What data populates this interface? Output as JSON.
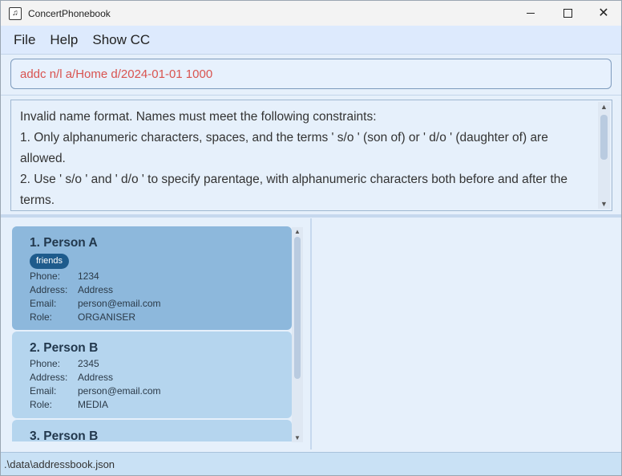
{
  "window": {
    "title": "ConcertPhonebook",
    "app_icon": "music-note-icon",
    "controls": {
      "minimize": "minimize-icon",
      "maximize": "maximize-icon",
      "close": "close-icon"
    }
  },
  "menu": {
    "items": [
      {
        "label": "File"
      },
      {
        "label": "Help"
      },
      {
        "label": "Show CC"
      }
    ]
  },
  "command": {
    "value": "addc n/l a/Home d/2024-01-01 1000",
    "text_color": "#d9534f"
  },
  "result": {
    "text": "Invalid name format. Names must meet the following constraints:\n1. Only alphanumeric characters, spaces, and the terms ' s/o ' (son of) or ' d/o ' (daughter of) are allowed.\n2. Use ' s/o ' and ' d/o ' to specify parentage, with alphanumeric characters both before and after the terms."
  },
  "persons": [
    {
      "name": "1. Person A",
      "tags": [
        "friends"
      ],
      "fields": [
        {
          "key": "Phone:",
          "value": "1234"
        },
        {
          "key": "Address:",
          "value": "Address"
        },
        {
          "key": "Email:",
          "value": "person@email.com"
        },
        {
          "key": "Role:",
          "value": "ORGANISER"
        }
      ],
      "selected": true
    },
    {
      "name": "2. Person B",
      "tags": [],
      "fields": [
        {
          "key": "Phone:",
          "value": "2345"
        },
        {
          "key": "Address:",
          "value": "Address"
        },
        {
          "key": "Email:",
          "value": "person@email.com"
        },
        {
          "key": "Role:",
          "value": "MEDIA"
        }
      ],
      "selected": false
    },
    {
      "name": "3. Person B",
      "tags": [],
      "fields": [],
      "selected": false
    }
  ],
  "status": {
    "path": ".\\data\\addressbook.json"
  },
  "colors": {
    "accent": "#1e5b8c",
    "selected_card": "#8db8dc",
    "card": "#b5d5ee"
  }
}
